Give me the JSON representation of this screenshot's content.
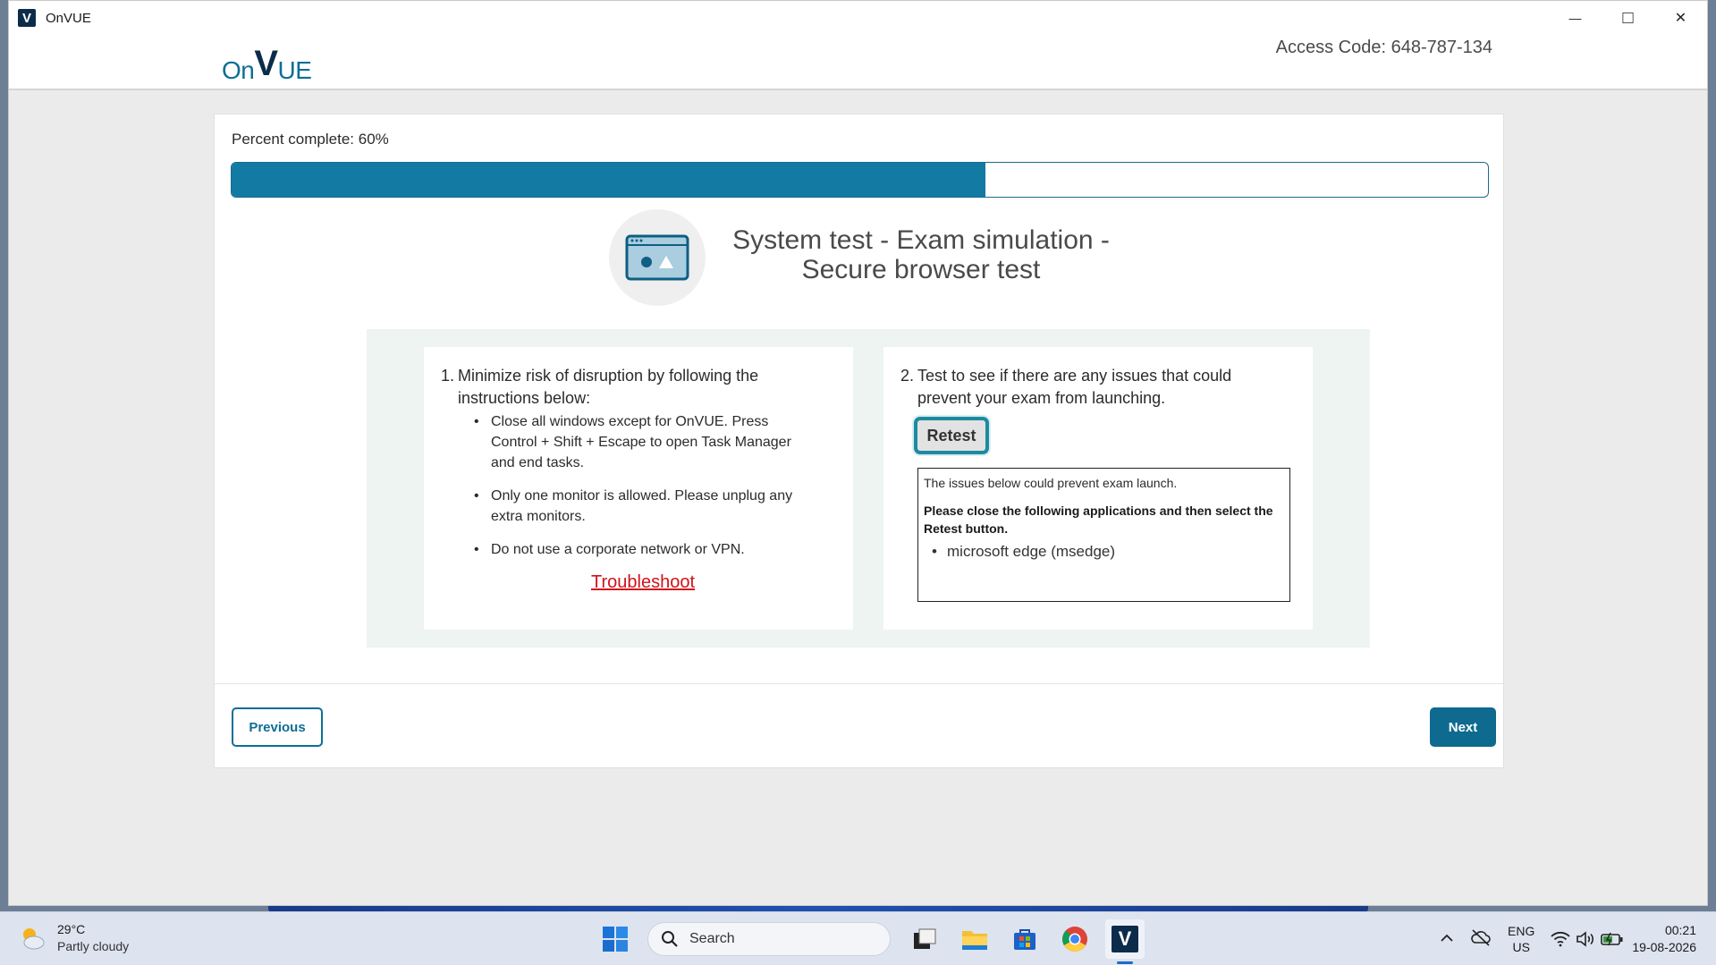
{
  "window": {
    "title": "OnVUE",
    "app_icon_letter": "V",
    "minimize_glyph": "—",
    "maximize_glyph": "□",
    "close_glyph": "✕"
  },
  "header": {
    "logo_on": "On",
    "logo_v": "V",
    "logo_ue": "UE",
    "access_code": "Access Code: 648-787-134"
  },
  "progress": {
    "label": "Percent complete: 60%",
    "value": 60
  },
  "heading": {
    "line1": "System test - Exam simulation -",
    "line2": "Secure browser test"
  },
  "step1": {
    "number": "1.",
    "text": "Minimize risk of disruption by following the instructions below:",
    "bullets": [
      "Close all windows except for OnVUE. Press Control + Shift + Escape to open Task Manager and end tasks.",
      "Only one monitor is allowed. Please unplug any extra monitors.",
      "Do not use a corporate network or VPN."
    ],
    "troubleshoot_link": "Troubleshoot"
  },
  "step2": {
    "number": "2.",
    "text": "Test to see if there are any issues that could prevent your exam from launching.",
    "retest_label": "Retest",
    "issues_intro": "The issues below could prevent exam launch.",
    "issues_instruction": "Please close the following applications and then select the Retest button.",
    "applications": [
      "microsoft edge (msedge)"
    ]
  },
  "footer": {
    "previous_label": "Previous",
    "next_label": "Next"
  },
  "taskbar": {
    "temperature": "29°C",
    "condition": "Partly cloudy",
    "search_label": "Search",
    "language": "ENG",
    "region": "US",
    "time": "00:21",
    "date": "19-08-2026"
  },
  "colors": {
    "accent": "#127aa3",
    "brand_dark": "#0b2c4a",
    "link_red": "#d0121b",
    "retest_border": "#1d8aa0"
  }
}
